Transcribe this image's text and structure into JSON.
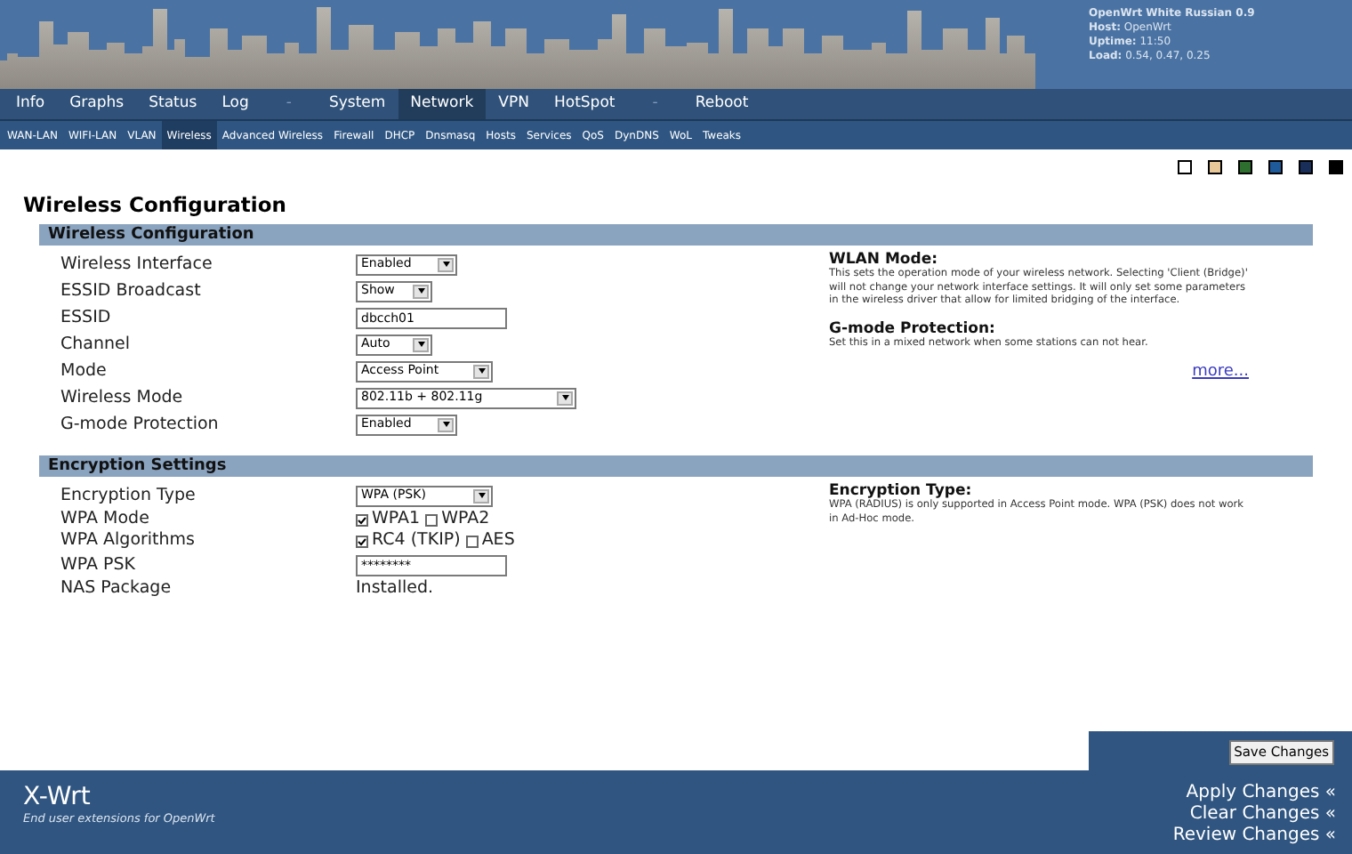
{
  "header": {
    "info": [
      {
        "label": "OpenWrt White Russian 0.9"
      },
      {
        "label": "Host:",
        "value": "OpenWrt"
      },
      {
        "label": "Uptime:",
        "value": "11:50"
      },
      {
        "label": "Load:",
        "value": "0.54, 0.47, 0.25"
      }
    ]
  },
  "main_nav": [
    {
      "label": "Info",
      "selected": false,
      "kind": "link"
    },
    {
      "label": "Graphs",
      "selected": false,
      "kind": "link"
    },
    {
      "label": "Status",
      "selected": false,
      "kind": "link"
    },
    {
      "label": "Log",
      "selected": false,
      "kind": "link"
    },
    {
      "label": "-",
      "selected": false,
      "kind": "separator"
    },
    {
      "label": "System",
      "selected": false,
      "kind": "link"
    },
    {
      "label": "Network",
      "selected": true,
      "kind": "link"
    },
    {
      "label": "VPN",
      "selected": false,
      "kind": "link"
    },
    {
      "label": "HotSpot",
      "selected": false,
      "kind": "link"
    },
    {
      "label": "-",
      "selected": false,
      "kind": "separator"
    },
    {
      "label": "Reboot",
      "selected": false,
      "kind": "link"
    }
  ],
  "sub_nav": [
    {
      "label": "WAN-LAN",
      "selected": false
    },
    {
      "label": "WIFI-LAN",
      "selected": false
    },
    {
      "label": "VLAN",
      "selected": false
    },
    {
      "label": "Wireless",
      "selected": true
    },
    {
      "label": "Advanced Wireless",
      "selected": false
    },
    {
      "label": "Firewall",
      "selected": false
    },
    {
      "label": "DHCP",
      "selected": false
    },
    {
      "label": "Dnsmasq",
      "selected": false
    },
    {
      "label": "Hosts",
      "selected": false
    },
    {
      "label": "Services",
      "selected": false
    },
    {
      "label": "QoS",
      "selected": false
    },
    {
      "label": "DynDNS",
      "selected": false
    },
    {
      "label": "WoL",
      "selected": false
    },
    {
      "label": "Tweaks",
      "selected": false
    }
  ],
  "themes": [
    {
      "color": "#ffffff"
    },
    {
      "color": "#e8c898"
    },
    {
      "color": "#2e6e2e"
    },
    {
      "color": "#1f5a9a"
    },
    {
      "color": "#1a2e5a"
    },
    {
      "color": "#000000"
    }
  ],
  "page_title": "Wireless Configuration",
  "sections": [
    {
      "title": "Wireless Configuration",
      "fields": [
        {
          "label": "Wireless Interface",
          "kind": "select",
          "value": "Enabled"
        },
        {
          "label": "ESSID Broadcast",
          "kind": "select",
          "value": "Show"
        },
        {
          "label": "ESSID",
          "kind": "text",
          "value": "dbcch01"
        },
        {
          "label": "Channel",
          "kind": "select",
          "value": "Auto"
        },
        {
          "label": "Mode",
          "kind": "select",
          "value": "Access Point"
        },
        {
          "label": "Wireless Mode",
          "kind": "select",
          "value": "802.11b + 802.11g"
        },
        {
          "label": "G-mode Protection",
          "kind": "select",
          "value": "Enabled"
        }
      ],
      "help": [
        {
          "title": "WLAN Mode:",
          "text": "This sets the operation mode of your wireless network. Selecting 'Client (Bridge)' will not change your network interface settings. It will only set some parameters in the wireless driver that allow for limited bridging of the interface."
        },
        {
          "title": "G-mode Protection:",
          "text": "Set this in a mixed network when some stations can not hear."
        }
      ],
      "more_link": "more..."
    },
    {
      "title": "Encryption Settings",
      "fields": [
        {
          "label": "Encryption Type",
          "kind": "select",
          "value": "WPA (PSK)"
        },
        {
          "label": "WPA Mode",
          "kind": "checkboxes",
          "options": [
            {
              "label": "WPA1",
              "checked": true
            },
            {
              "label": "WPA2",
              "checked": false
            }
          ]
        },
        {
          "label": "WPA Algorithms",
          "kind": "checkboxes",
          "options": [
            {
              "label": "RC4 (TKIP)",
              "checked": true
            },
            {
              "label": "AES",
              "checked": false
            }
          ]
        },
        {
          "label": "WPA PSK",
          "kind": "text",
          "value": "********"
        },
        {
          "label": "NAS Package",
          "kind": "static",
          "value": "Installed."
        }
      ],
      "help": [
        {
          "title": "Encryption Type:",
          "text": "WPA (RADIUS) is only supported in Access Point mode. WPA (PSK) does not work in Ad-Hoc mode."
        }
      ]
    }
  ],
  "save_button": "Save Changes",
  "footer": {
    "brand": "X-Wrt",
    "tagline": "End user extensions for OpenWrt",
    "links": [
      "Apply Changes «",
      "Clear Changes «",
      "Review Changes «"
    ]
  }
}
